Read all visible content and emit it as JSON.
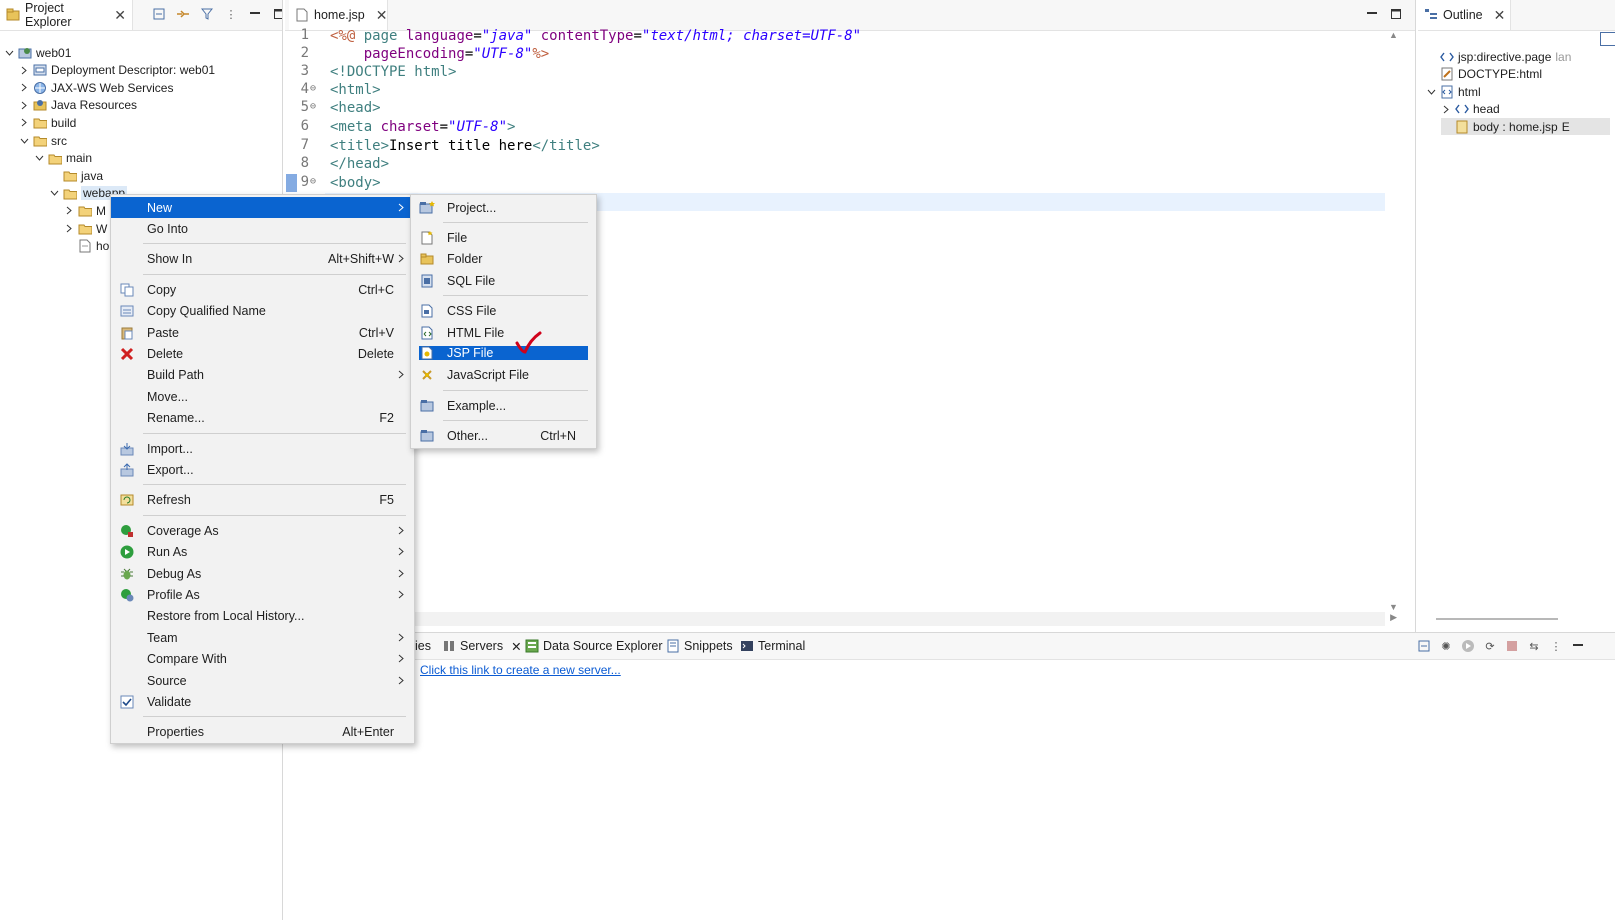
{
  "project_explorer": {
    "tab_label": "Project Explorer",
    "tree": [
      {
        "label": "web01",
        "depth": 0,
        "twisty": "v"
      },
      {
        "label": "Deployment Descriptor: web01",
        "depth": 1,
        "twisty": ">"
      },
      {
        "label": "JAX-WS Web Services",
        "depth": 1,
        "twisty": ">"
      },
      {
        "label": "Java Resources",
        "depth": 1,
        "twisty": ">"
      },
      {
        "label": "build",
        "depth": 1,
        "twisty": ">"
      },
      {
        "label": "src",
        "depth": 1,
        "twisty": "v"
      },
      {
        "label": "main",
        "depth": 2,
        "twisty": "v"
      },
      {
        "label": "java",
        "depth": 3,
        "twisty": ""
      },
      {
        "label": "webapp",
        "depth": 3,
        "twisty": "v"
      },
      {
        "label": "M",
        "depth": 4,
        "twisty": ">"
      },
      {
        "label": "W",
        "depth": 4,
        "twisty": ">"
      },
      {
        "label": "ho",
        "depth": 4,
        "twisty": ""
      }
    ]
  },
  "editor": {
    "tab_label": "home.jsp",
    "lines": [
      {
        "n": "1",
        "fold": ""
      },
      {
        "n": "2",
        "fold": ""
      },
      {
        "n": "3",
        "fold": ""
      },
      {
        "n": "4",
        "fold": "⊖"
      },
      {
        "n": "5",
        "fold": "⊖"
      },
      {
        "n": "6",
        "fold": ""
      },
      {
        "n": "7",
        "fold": ""
      },
      {
        "n": "8",
        "fold": ""
      },
      {
        "n": "9",
        "fold": "⊖"
      }
    ],
    "code": {
      "l1_a": "<%@ ",
      "l1_b": "page ",
      "l1_c": "language",
      "l1_d": "=",
      "l1_e": "\"java\"",
      "l1_f": " contentType",
      "l1_g": "=",
      "l1_h": "\"text/html; charset=UTF-8\"",
      "l2_a": "    pageEncoding",
      "l2_b": "=",
      "l2_c": "\"UTF-8\"",
      "l2_d": "%>",
      "l3": "<!DOCTYPE html>",
      "l4": "<html>",
      "l5": "<head>",
      "l6_a": "<meta ",
      "l6_b": "charset",
      "l6_c": "=",
      "l6_d": "\"UTF-8\"",
      "l6_e": ">",
      "l7_a": "<title>",
      "l7_b": "Insert title here",
      "l7_c": "</title>",
      "l8": "</head>",
      "l9": "<body>"
    }
  },
  "outline": {
    "tab_label": "Outline",
    "items": [
      {
        "label": "jsp:directive.page",
        "extra": "lan",
        "depth": 0,
        "twisty": ""
      },
      {
        "label": "DOCTYPE:html",
        "depth": 0,
        "twisty": ""
      },
      {
        "label": "html",
        "depth": 0,
        "twisty": "v"
      },
      {
        "label": "head",
        "depth": 1,
        "twisty": ">"
      },
      {
        "label": "body : home.jsp",
        "extra": "E",
        "depth": 1,
        "twisty": ""
      }
    ]
  },
  "context_menu": {
    "items": [
      {
        "label": "New",
        "shortcut": "",
        "arrow": true,
        "icon": "",
        "highlighted": true
      },
      {
        "label": "Go Into",
        "shortcut": "",
        "arrow": false,
        "icon": ""
      },
      {
        "sep": true
      },
      {
        "label": "Show In",
        "shortcut": "Alt+Shift+W",
        "arrow": true,
        "icon": ""
      },
      {
        "sep": true
      },
      {
        "label": "Copy",
        "shortcut": "Ctrl+C",
        "arrow": false,
        "icon": "copy-icon"
      },
      {
        "label": "Copy Qualified Name",
        "shortcut": "",
        "arrow": false,
        "icon": "copy-qualified-icon"
      },
      {
        "label": "Paste",
        "shortcut": "Ctrl+V",
        "arrow": false,
        "icon": "paste-icon"
      },
      {
        "label": "Delete",
        "shortcut": "Delete",
        "arrow": false,
        "icon": "delete-icon"
      },
      {
        "label": "Build Path",
        "shortcut": "",
        "arrow": true,
        "icon": ""
      },
      {
        "label": "Move...",
        "shortcut": "",
        "arrow": false,
        "icon": ""
      },
      {
        "label": "Rename...",
        "shortcut": "F2",
        "arrow": false,
        "icon": ""
      },
      {
        "sep": true
      },
      {
        "label": "Import...",
        "shortcut": "",
        "arrow": false,
        "icon": "import-icon"
      },
      {
        "label": "Export...",
        "shortcut": "",
        "arrow": false,
        "icon": "export-icon"
      },
      {
        "sep": true
      },
      {
        "label": "Refresh",
        "shortcut": "F5",
        "arrow": false,
        "icon": "refresh-icon"
      },
      {
        "sep": true
      },
      {
        "label": "Coverage As",
        "shortcut": "",
        "arrow": true,
        "icon": "coverage-icon"
      },
      {
        "label": "Run As",
        "shortcut": "",
        "arrow": true,
        "icon": "run-icon"
      },
      {
        "label": "Debug As",
        "shortcut": "",
        "arrow": true,
        "icon": "debug-icon"
      },
      {
        "label": "Profile As",
        "shortcut": "",
        "arrow": true,
        "icon": "profile-icon"
      },
      {
        "label": "Restore from Local History...",
        "shortcut": "",
        "arrow": false,
        "icon": ""
      },
      {
        "label": "Team",
        "shortcut": "",
        "arrow": true,
        "icon": ""
      },
      {
        "label": "Compare With",
        "shortcut": "",
        "arrow": true,
        "icon": ""
      },
      {
        "label": "Source",
        "shortcut": "",
        "arrow": true,
        "icon": ""
      },
      {
        "label": "Validate",
        "shortcut": "",
        "arrow": false,
        "icon": "checkbox-icon"
      },
      {
        "sep": true
      },
      {
        "label": "Properties",
        "shortcut": "Alt+Enter",
        "arrow": false,
        "icon": ""
      }
    ]
  },
  "new_submenu": {
    "items": [
      {
        "label": "Project...",
        "shortcut": "",
        "icon": "project-icon"
      },
      {
        "sep": true
      },
      {
        "label": "File",
        "shortcut": "",
        "icon": "file-icon"
      },
      {
        "label": "Folder",
        "shortcut": "",
        "icon": "folder-icon"
      },
      {
        "label": "SQL File",
        "shortcut": "",
        "icon": "sql-file-icon"
      },
      {
        "sep": true
      },
      {
        "label": "CSS File",
        "shortcut": "",
        "icon": "css-file-icon"
      },
      {
        "label": "HTML File",
        "shortcut": "",
        "icon": "html-file-icon"
      },
      {
        "label": "JSP File",
        "shortcut": "",
        "icon": "jsp-file-icon",
        "highlighted": true
      },
      {
        "label": "JavaScript File",
        "shortcut": "",
        "icon": "javascript-file-icon"
      },
      {
        "sep": true
      },
      {
        "label": "Example...",
        "shortcut": "",
        "icon": "example-icon"
      },
      {
        "sep": true
      },
      {
        "label": "Other...",
        "shortcut": "Ctrl+N",
        "icon": "other-icon"
      }
    ]
  },
  "bottom_panel": {
    "tabs": [
      {
        "label": "ies",
        "icon": ""
      },
      {
        "label": "Servers",
        "icon": "servers-icon",
        "active": true
      },
      {
        "label": "Data Source Explorer",
        "icon": "data-source-icon"
      },
      {
        "label": "Snippets",
        "icon": "snippets-icon"
      },
      {
        "label": "Terminal",
        "icon": "terminal-icon"
      }
    ],
    "link_text": "Click this link to create a new server..."
  },
  "colors": {
    "highlight": "#0a64d0",
    "annotation_check": "#d0021b"
  }
}
